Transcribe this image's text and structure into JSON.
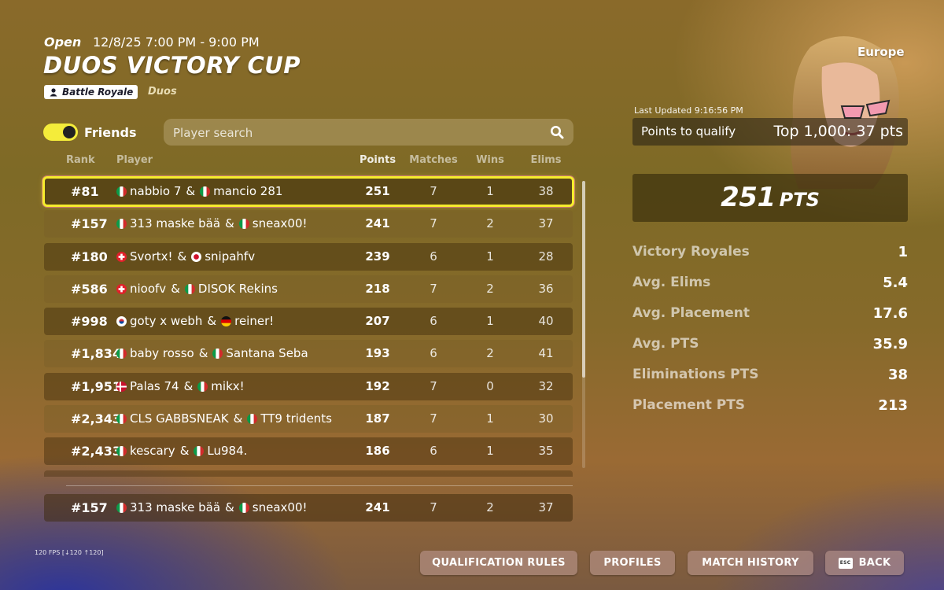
{
  "header": {
    "status": "Open",
    "date_range": "12/8/25 7:00 PM - 9:00 PM",
    "title": "DUOS VICTORY CUP",
    "mode_badge": "Battle Royale",
    "mode_sub": "Duos"
  },
  "filters": {
    "friends_label": "Friends",
    "friends_toggle_on": true,
    "search_placeholder": "Player search"
  },
  "table": {
    "columns": {
      "rank": "Rank",
      "player": "Player",
      "points": "Points",
      "matches": "Matches",
      "wins": "Wins",
      "elims": "Elims"
    },
    "rows": [
      {
        "rank": "#81",
        "p1": "nabbio 7",
        "f1": "it",
        "p2": "mancio 281",
        "f2": "it",
        "points": "251",
        "matches": "7",
        "wins": "1",
        "elims": "38",
        "highlight": true
      },
      {
        "rank": "#157",
        "p1": "313 maske bää",
        "f1": "it",
        "p2": "sneax00!",
        "f2": "it",
        "points": "241",
        "matches": "7",
        "wins": "2",
        "elims": "37"
      },
      {
        "rank": "#180",
        "p1": "Svortx!",
        "f1": "ch",
        "p2": "snipahfv",
        "f2": "jp",
        "points": "239",
        "matches": "6",
        "wins": "1",
        "elims": "28"
      },
      {
        "rank": "#586",
        "p1": "nioofv",
        "f1": "ch",
        "p2": "DISOK Rekins",
        "f2": "it",
        "points": "218",
        "matches": "7",
        "wins": "2",
        "elims": "36"
      },
      {
        "rank": "#998",
        "p1": "goty x webh",
        "f1": "kr",
        "p2": "reiner!",
        "f2": "de",
        "points": "207",
        "matches": "6",
        "wins": "1",
        "elims": "40"
      },
      {
        "rank": "#1,834",
        "p1": "baby rosso",
        "f1": "it",
        "p2": "Santana Seba",
        "f2": "it",
        "points": "193",
        "matches": "6",
        "wins": "2",
        "elims": "41"
      },
      {
        "rank": "#1,951",
        "p1": "Palas 74",
        "f1": "dk",
        "p2": "mikx!",
        "f2": "it",
        "points": "192",
        "matches": "7",
        "wins": "0",
        "elims": "32"
      },
      {
        "rank": "#2,343",
        "p1": "CLS GABBSNEAK",
        "f1": "it",
        "p2": "TT9 tridents",
        "f2": "it",
        "points": "187",
        "matches": "7",
        "wins": "1",
        "elims": "30"
      },
      {
        "rank": "#2,433",
        "p1": "kescary",
        "f1": "it",
        "p2": "Lu984.",
        "f2": "it",
        "points": "186",
        "matches": "6",
        "wins": "1",
        "elims": "35"
      }
    ],
    "pinned_row": {
      "rank": "#157",
      "p1": "313 maske bää",
      "f1": "it",
      "p2": "sneax00!",
      "f2": "it",
      "points": "241",
      "matches": "7",
      "wins": "2",
      "elims": "37"
    },
    "separator": "&"
  },
  "panel": {
    "region": "Europe",
    "last_updated": "Last Updated 9:16:56 PM",
    "qualify_label": "Points to qualify",
    "qualify_value": "Top 1,000: 37 pts",
    "points_big": "251",
    "points_unit": "PTS",
    "stats": [
      {
        "label": "Victory Royales",
        "value": "1"
      },
      {
        "label": "Avg. Elims",
        "value": "5.4"
      },
      {
        "label": "Avg. Placement",
        "value": "17.6"
      },
      {
        "label": "Avg. PTS",
        "value": "35.9"
      },
      {
        "label": "Eliminations PTS",
        "value": "38"
      },
      {
        "label": "Placement PTS",
        "value": "213"
      }
    ]
  },
  "footer": {
    "fps": "120 FPS [↓120 ↑120]",
    "buttons": {
      "qualification": "QUALIFICATION RULES",
      "profiles": "PROFILES",
      "history": "MATCH HISTORY",
      "back": "BACK",
      "back_key": "ESC"
    }
  },
  "colors": {
    "accent_yellow": "#f6ed2c",
    "toggle_on": "#f4ec3a"
  }
}
